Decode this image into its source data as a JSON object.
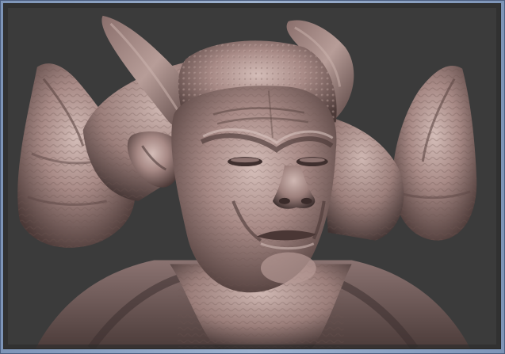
{
  "viewport": {
    "background": "#3a3a3a",
    "subject": "sculpted-creature-bust"
  },
  "colors": {
    "clay_base": "#a88a86",
    "clay_shadow": "#5b4643",
    "clay_highlight": "#d7c2bd",
    "frame": "#8aa0c0"
  }
}
